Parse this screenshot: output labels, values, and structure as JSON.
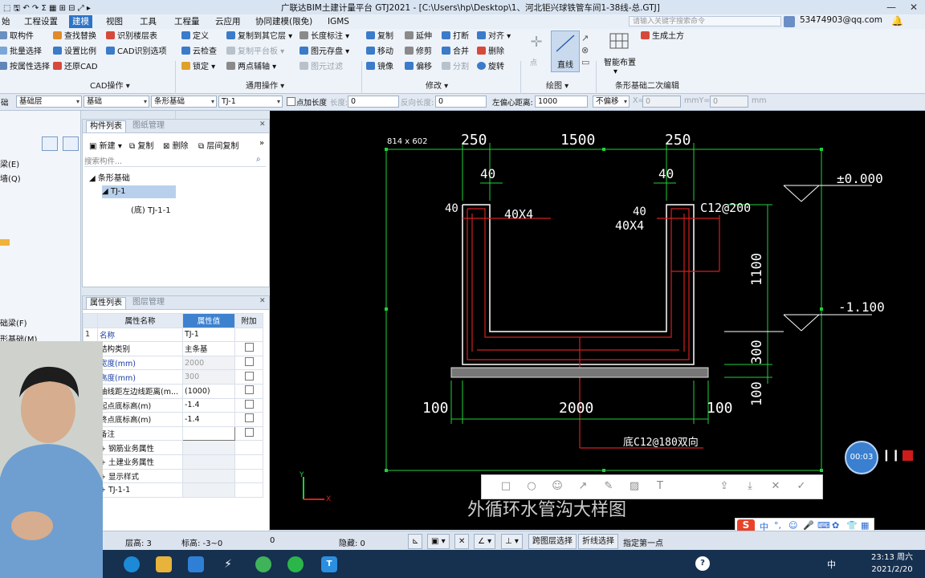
{
  "titlebar": {
    "title": "广联达BIM土建计量平台 GTJ2021 - [C:\\Users\\hp\\Desktop\\1、河北钜兴球铁管车间1-38线-总.GTJ]"
  },
  "menubar": {
    "items": [
      "始",
      "工程设置",
      "建模",
      "视图",
      "工具",
      "工程量",
      "云应用",
      "协同建模(限免)",
      "IGMS"
    ],
    "active": "建模",
    "search_placeholder": "请输入关键字搜索命令",
    "account": "53474903@qq.com"
  },
  "ribbon": {
    "cad_group": {
      "label": "CAD操作",
      "buttons": [
        "查找替换",
        "识别楼层表",
        "设置比例",
        "CAD识别选项",
        "还原CAD",
        "取构件",
        "批量选择",
        "按属性选择"
      ]
    },
    "general_group": {
      "label": "通用操作",
      "buttons": [
        "定义",
        "复制到其它层",
        "长度标注",
        "云检查",
        "复制平台板",
        "图元存盘",
        "锁定",
        "两点辅轴",
        "图元过滤"
      ]
    },
    "modify_group": {
      "label": "修改",
      "buttons": [
        "复制",
        "延伸",
        "打断",
        "对齐",
        "移动",
        "修剪",
        "合并",
        "删除",
        "镜像",
        "偏移",
        "分割",
        "旋转"
      ]
    },
    "draw_group": {
      "label": "绘图",
      "buttons": [
        "点",
        "直线"
      ]
    },
    "strip_group": {
      "label": "条形基础二次编辑",
      "buttons": [
        "智能布置",
        "生成土方"
      ]
    }
  },
  "propbar": {
    "floor": "基础层",
    "category": "基础",
    "type": "条形基础",
    "element": "TJ-1",
    "checkbox_label": "点加长度",
    "length_label": "长度:",
    "length_value": "0",
    "reverse_label": "反向长度:",
    "reverse_value": "0",
    "offset_label": "左偏心距离:",
    "offset_value": "1000",
    "mode": "不偏移",
    "x_label": "X=",
    "x_value": "0",
    "mm1": "mm",
    "y_label": "mmY=",
    "y_value": "0",
    "mm2": "mm",
    "left_short": "础"
  },
  "leftstrip": {
    "items": [
      "梁(E)",
      "墙(Q)",
      "础梁(F)",
      "形基础(M)"
    ]
  },
  "complist": {
    "tabs": [
      "构件列表",
      "图纸管理"
    ],
    "toolbar": [
      "新建",
      "复制",
      "删除",
      "层间复制"
    ],
    "search_placeholder": "搜索构件...",
    "tree": [
      {
        "label": "条形基础",
        "level": 0
      },
      {
        "label": "TJ-1",
        "level": 1,
        "selected": true
      },
      {
        "label": "(底) TJ-1-1",
        "level": 2
      }
    ]
  },
  "proplist": {
    "tabs": [
      "属性列表",
      "图层管理"
    ],
    "headers": [
      "",
      "属性名称",
      "属性值",
      "附加"
    ],
    "rows": [
      {
        "n": "1",
        "name": "名称",
        "value": "TJ-1",
        "extra": false
      },
      {
        "n": "",
        "name": "结构类别",
        "value": "主条基",
        "extra": true
      },
      {
        "n": "",
        "name": "宽度(mm)",
        "value": "2000",
        "extra": true
      },
      {
        "n": "",
        "name": "高度(mm)",
        "value": "300",
        "extra": true
      },
      {
        "n": "",
        "name": "轴线距左边线距离(m...",
        "value": "(1000)",
        "extra": true
      },
      {
        "n": "",
        "name": "起点底标高(m)",
        "value": "-1.4",
        "extra": true
      },
      {
        "n": "",
        "name": "终点底标高(m)",
        "value": "-1.4",
        "extra": true
      },
      {
        "n": "",
        "name": "备注",
        "value": "",
        "extra": true
      },
      {
        "n": "",
        "name": "+ 钢筋业务属性",
        "value": "",
        "extra": false
      },
      {
        "n": "",
        "name": "+ 土建业务属性",
        "value": "",
        "extra": false
      },
      {
        "n": "",
        "name": "+ 显示样式",
        "value": "",
        "extra": false
      },
      {
        "n": "",
        "name": "+ TJ-1-1",
        "value": "",
        "extra": false
      }
    ]
  },
  "canvas": {
    "size_label": "814 x 602",
    "dims_top": [
      "250",
      "1500",
      "250"
    ],
    "dims_40": [
      "40",
      "40",
      "40",
      "40"
    ],
    "rebar_labels": [
      "40X4",
      "40X4",
      "C12@200"
    ],
    "elevations": [
      "±0.000",
      "-1.100"
    ],
    "dims_right": [
      "1100",
      "300",
      "100"
    ],
    "dims_bottom": [
      "100",
      "2000",
      "100"
    ],
    "bottom_rebar": "底C12@180双向",
    "drawing_title": "外循环水管沟大样图",
    "axis_x": "X",
    "axis_y": "Y"
  },
  "statusbar": {
    "floor_height": "层高: 3",
    "elevation": "标高: -3~0",
    "zero": "0",
    "hidden": "隐藏: 0",
    "btn1": "跨图层选择",
    "btn2": "折线选择",
    "hint": "指定第一点"
  },
  "recorder": {
    "time": "00:03"
  },
  "ime": {
    "lang": "中"
  },
  "taskbar": {
    "time": "23:13 周六",
    "date": "2021/2/20",
    "ime": "中"
  },
  "colors": {
    "accent": "#2d73c6",
    "cad_green": "#1fd13a",
    "cad_red": "#d12020",
    "cad_white": "#ffffff"
  }
}
